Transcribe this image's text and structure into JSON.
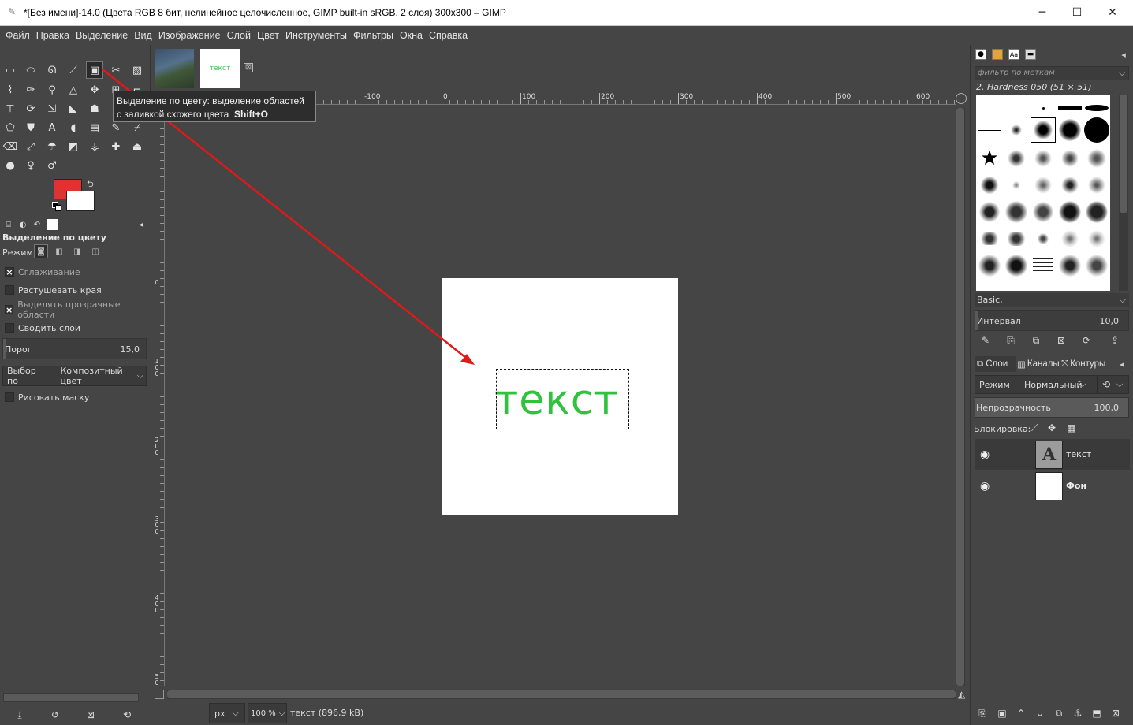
{
  "window": {
    "title": "*[Без имени]-14.0 (Цвета RGB 8 бит, нелинейное целочисленное, GIMP built-in sRGB, 2 слоя) 300x300 – GIMP",
    "min_glyph": "─",
    "max_glyph": "☐",
    "close_glyph": "✕"
  },
  "menu": [
    "Файл",
    "Правка",
    "Выделение",
    "Вид",
    "Изображение",
    "Слой",
    "Цвет",
    "Инструменты",
    "Фильтры",
    "Окна",
    "Справка"
  ],
  "colors": {
    "foreground": "#e13131",
    "background": "#ffffff",
    "text_layer_color": "#2fc23e"
  },
  "tooltip": {
    "line1": "Выделение по цвету: выделение областей",
    "line2": "с заливкой схожего цвета",
    "shortcut": "Shift+O"
  },
  "image_tabs": {
    "thumb2_text": "текст",
    "close_glyph": "⊠"
  },
  "tool_options": {
    "title": "Выделение по цвету",
    "mode_label": "Режим:",
    "antialias": {
      "label": "Сглаживание",
      "checked": true
    },
    "feather": {
      "label": "Растушевать края",
      "checked": false
    },
    "select_transparent": {
      "label": "Выделять прозрачные области",
      "checked": true
    },
    "sample_merged": {
      "label": "Сводить слои",
      "checked": false
    },
    "threshold": {
      "label": "Порог",
      "value": "15,0"
    },
    "select_by": {
      "label": "Выбор по",
      "value": "Композитный цвет"
    },
    "draw_mask": {
      "label": "Рисовать маску",
      "checked": false
    }
  },
  "rulers": {
    "top_labels": [
      "-100",
      "0",
      "100",
      "200",
      "300",
      "400",
      "500",
      "600"
    ],
    "left_labels": [
      "0",
      "100",
      "200",
      "300",
      "400",
      "500"
    ]
  },
  "canvas": {
    "text": "текст"
  },
  "statusbar": {
    "unit": "px",
    "zoom": "100 %",
    "text": "текст (896,9 kB)"
  },
  "brushes": {
    "filter_placeholder": "фильтр по меткам",
    "current": "2. Hardness 050 (51 × 51)",
    "set": "Basic,",
    "spacing_label": "Интервал",
    "spacing_value": "10,0"
  },
  "layers_panel": {
    "tabs": [
      "Слои",
      "Каналы",
      "Контуры"
    ],
    "mode_label": "Режим",
    "mode_value": "Нормальный",
    "opacity_label": "Непрозрачность",
    "opacity_value": "100,0",
    "lock_label": "Блокировка:",
    "layers": [
      {
        "name": "текст",
        "visible": true,
        "type": "text"
      },
      {
        "name": "Фон",
        "visible": true,
        "type": "raster"
      }
    ]
  }
}
